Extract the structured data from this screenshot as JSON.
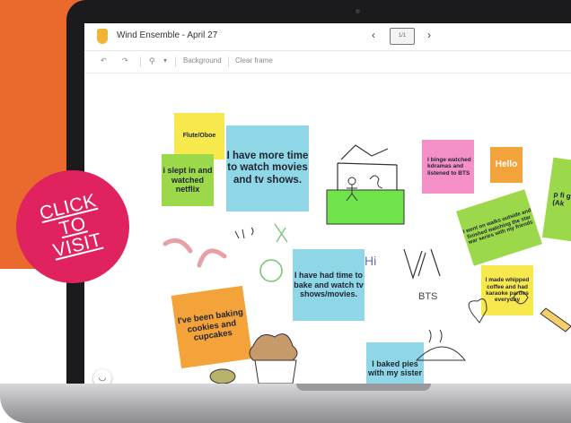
{
  "app": {
    "title": "Wind Ensemble - April 27",
    "nav_prev": "‹",
    "nav_next": "›",
    "frame_label": "1/1"
  },
  "toolbar": {
    "undo_icon": "undo-icon",
    "redo_icon": "redo-icon",
    "zoom_icon": "zoom-icon",
    "zoom_menu": "▾",
    "background_label": "Background",
    "clear_label": "Clear frame"
  },
  "notes": [
    {
      "text": "Flute/Oboe",
      "color": "#f7e84e"
    },
    {
      "text": "I have more time to watch movies and tv shows.",
      "color": "#8fd6e6"
    },
    {
      "text": "i slept in and watched netflix",
      "color": "#9bd84a"
    },
    {
      "text": "I have had time to bake and watch tv shows/movies.",
      "color": "#8fd6e6"
    },
    {
      "text": "I've been baking cookies and cupcakes",
      "color": "#f3a33a"
    },
    {
      "text": "I baked pies with my sister",
      "color": "#8fd6e6"
    },
    {
      "text": "I binge watched kdramas and listened to BTS",
      "color": "#f58fc7"
    },
    {
      "text": "Hello",
      "color": "#f3a33a"
    },
    {
      "text": "I went on walks outside and finished watching the star war series with my friends",
      "color": "#9bd84a"
    },
    {
      "text": "I made whipped coffee and had karaoke parties everyday",
      "color": "#f7e84e"
    },
    {
      "text": "p fi go (Ak",
      "color": "#9bd84a"
    }
  ],
  "doodles": {
    "bts_text": "BTS",
    "hi_text": "Hi"
  },
  "cta": {
    "line1": "CLICK",
    "line2": "TO",
    "line3": "VISIT"
  },
  "colors": {
    "orange_bg": "#ea6a2e",
    "cta_pink": "#e0225f",
    "laptop_bezel": "#1b1b1d"
  }
}
